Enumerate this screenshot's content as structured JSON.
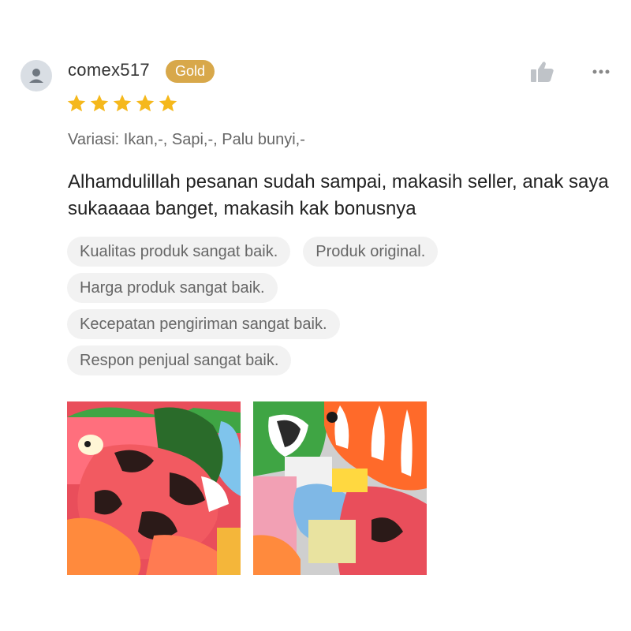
{
  "review": {
    "username": "comex517",
    "badge": "Gold",
    "rating": 5,
    "variation": "Variasi: Ikan,-, Sapi,-, Palu bunyi,-",
    "text": "Alhamdulillah pesanan sudah sampai, makasih seller, anak saya sukaaaaa banget, makasih kak bonusnya",
    "tags": [
      "Kualitas produk sangat baik.",
      "Produk original.",
      "Harga produk sangat baik.",
      "Kecepatan pengiriman sangat baik.",
      "Respon penjual sangat baik."
    ],
    "photos": [
      {
        "description": "inflatable cow balloons"
      },
      {
        "description": "inflatable clownfish balloons"
      }
    ]
  },
  "icons": {
    "avatar": "user-icon",
    "like": "thumbs-up-icon",
    "more": "more-icon",
    "star": "star-icon"
  },
  "colors": {
    "badge": "#d8a84a",
    "star": "#f5b81c",
    "tag_background": "#f2f2f2"
  }
}
